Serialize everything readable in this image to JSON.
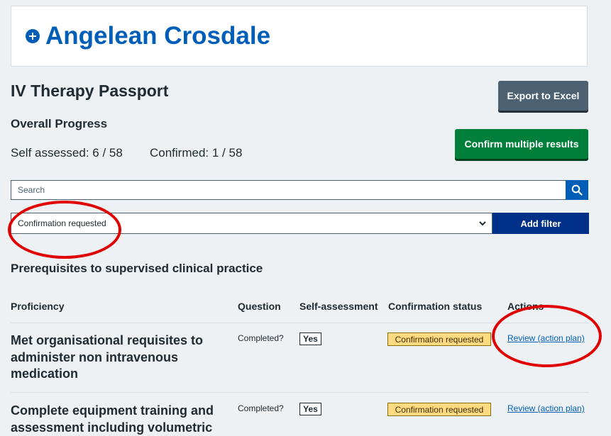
{
  "header": {
    "name": "Angelean Crosdale"
  },
  "page": {
    "title": "IV Therapy Passport",
    "progress_heading": "Overall Progress",
    "self_assessed": "Self assessed: 6 / 58",
    "confirmed": "Confirmed: 1 / 58"
  },
  "buttons": {
    "export": "Export to Excel",
    "confirm_multiple": "Confirm multiple results",
    "add_filter": "Add filter"
  },
  "search": {
    "placeholder": "Search",
    "value": ""
  },
  "filter": {
    "selected": "Confirmation requested"
  },
  "section": {
    "title": "Prerequisites to supervised clinical practice"
  },
  "table": {
    "headers": [
      "Proficiency",
      "Question",
      "Self-assessment",
      "Confirmation status",
      "Actions"
    ],
    "rows": [
      {
        "proficiency": "Met organisational requisites to administer non intravenous medication",
        "question": "Completed?",
        "self_assessment": "Yes",
        "status": "Confirmation requested",
        "action": "Review (action plan)"
      },
      {
        "proficiency": "Complete equipment training and assessment including volumetric",
        "question": "Completed?",
        "self_assessment": "Yes",
        "status": "Confirmation requested",
        "action": "Review (action plan)"
      }
    ]
  },
  "colors": {
    "brand_blue": "#005eb8",
    "dark_blue": "#003087",
    "green": "#007f3b",
    "grey_button": "#4c6272",
    "tag_yellow": "#ffda80",
    "annotation_red": "#e00000"
  },
  "icons": [
    "plus-circle-icon",
    "search-icon",
    "chevron-down-icon"
  ]
}
